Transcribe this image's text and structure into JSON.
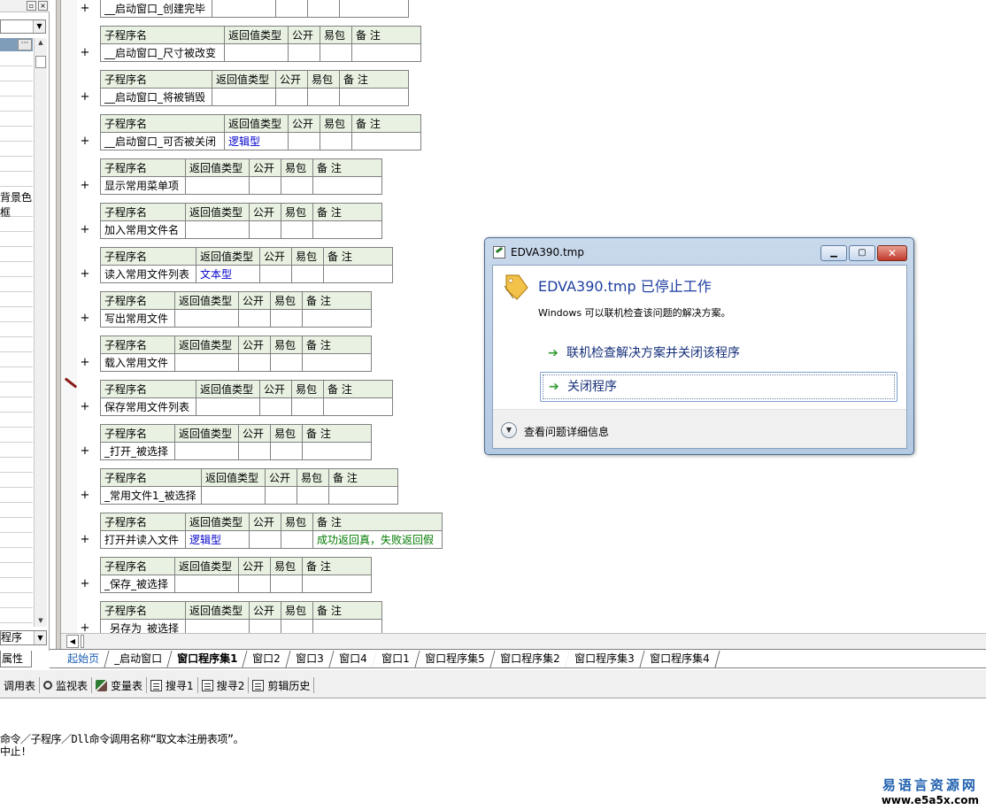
{
  "left_panel": {
    "labels": [
      "背景色",
      "框"
    ],
    "bottom_combo_value": "程序",
    "property_tab": "属性"
  },
  "sub_header": {
    "name": "子程序名",
    "return_type": "返回值类型",
    "public": "公开",
    "easy_pack": "易包",
    "remark": "备 注"
  },
  "subroutines": [
    {
      "name": "__启动窗口_创建完毕",
      "return_type": "",
      "remark": ""
    },
    {
      "name": "__启动窗口_尺寸被改变",
      "return_type": "",
      "remark": ""
    },
    {
      "name": "__启动窗口_将被销毁",
      "return_type": "",
      "remark": ""
    },
    {
      "name": "__启动窗口_可否被关闭",
      "return_type": "逻辑型",
      "remark": ""
    },
    {
      "name": "显示常用菜单项",
      "return_type": "",
      "remark": ""
    },
    {
      "name": "加入常用文件名",
      "return_type": "",
      "remark": ""
    },
    {
      "name": "读入常用文件列表",
      "return_type": "文本型",
      "remark": ""
    },
    {
      "name": "写出常用文件",
      "return_type": "",
      "remark": ""
    },
    {
      "name": "载入常用文件",
      "return_type": "",
      "remark": ""
    },
    {
      "name": "保存常用文件列表",
      "return_type": "",
      "remark": ""
    },
    {
      "name": "_打开_被选择",
      "return_type": "",
      "remark": ""
    },
    {
      "name": "_常用文件1_被选择",
      "return_type": "",
      "remark": ""
    },
    {
      "name": "打开并读入文件",
      "return_type": "逻辑型",
      "remark": "成功返回真，失败返回假"
    },
    {
      "name": "_保存_被选择",
      "return_type": "",
      "remark": ""
    },
    {
      "name": "_另存为_被选择",
      "return_type": "",
      "remark": ""
    }
  ],
  "tabs": [
    "起始页",
    "_启动窗口",
    "窗口程序集1",
    "窗口2",
    "窗口3",
    "窗口4",
    "窗口1",
    "窗口程序集5",
    "窗口程序集2",
    "窗口程序集3",
    "窗口程序集4"
  ],
  "active_tab": "窗口程序集1",
  "bottom_toolbar": {
    "items": [
      {
        "label": "调用表",
        "icon": "none"
      },
      {
        "label": "监视表",
        "icon": "magnifier-icon"
      },
      {
        "label": "变量表",
        "icon": "variables-icon"
      },
      {
        "label": "搜寻1",
        "icon": "find-icon"
      },
      {
        "label": "搜寻2",
        "icon": "find-icon"
      },
      {
        "label": "剪辑历史",
        "icon": "clipboard-icon"
      }
    ]
  },
  "output": {
    "line1": "命令／子程序／Dll命令调用名称“取文本注册表项”。",
    "line2": "中止!"
  },
  "watermark": {
    "title": "易语言资源网",
    "url": "www.e5a5x.com"
  },
  "dialog": {
    "title": "EDVA390.tmp",
    "heading": "EDVA390.tmp 已停止工作",
    "description": "Windows 可以联机检查该问题的解决方案。",
    "option_check": "联机检查解决方案并关闭该程序",
    "option_close": "关闭程序",
    "details": "查看问题详细信息"
  }
}
